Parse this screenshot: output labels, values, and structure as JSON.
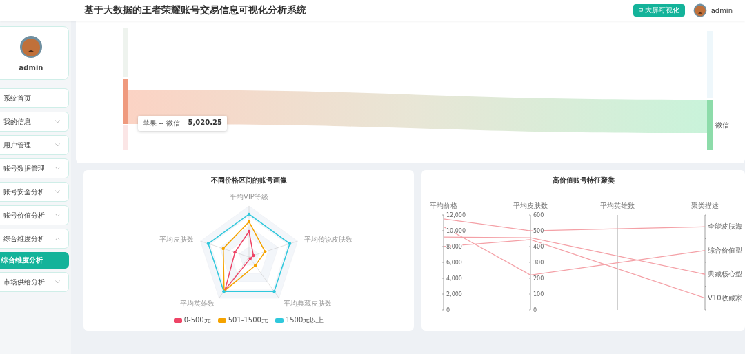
{
  "header": {
    "title": "基于大数据的王者荣耀账号交易信息可视化分析系统",
    "screen_button": "大屏可视化",
    "username": "admin"
  },
  "sidebar": {
    "profile": {
      "username": "admin"
    },
    "items": [
      {
        "label": "系统首页",
        "expandable": false
      },
      {
        "label": "我的信息",
        "expandable": true,
        "expanded": false
      },
      {
        "label": "用户管理",
        "expandable": true,
        "expanded": false
      },
      {
        "label": "账号数据管理",
        "expandable": true,
        "expanded": false
      },
      {
        "label": "账号安全分析",
        "expandable": true,
        "expanded": false
      },
      {
        "label": "账号价值分析",
        "expandable": true,
        "expanded": false
      },
      {
        "label": "综合维度分析",
        "expandable": true,
        "expanded": true,
        "children": [
          {
            "label": "综合维度分析",
            "selected": true
          }
        ]
      },
      {
        "label": "市场供给分析",
        "expandable": true,
        "expanded": false
      }
    ]
  },
  "sankey": {
    "tooltip": {
      "link": "苹果 -- 微信",
      "value": "5,020.25"
    },
    "target_label": "微信"
  },
  "radar": {
    "title": "不同价格区间的账号画像",
    "indicators": [
      "平均VIP等级",
      "平均皮肤数",
      "平均传说皮肤数",
      "平均英雄数",
      "平均典藏皮肤数"
    ],
    "legend": [
      {
        "name": "0-500元",
        "color": "#ee4466"
      },
      {
        "name": "501-1500元",
        "color": "#f5a300"
      },
      {
        "name": "1500元以上",
        "color": "#2fc8dc"
      }
    ]
  },
  "parallel": {
    "title": "高价值账号特征聚类",
    "axes": [
      {
        "name": "平均价格",
        "ticks": [
          "12,000",
          "10,000",
          "8,000",
          "6,000",
          "4,000",
          "2,000",
          "0"
        ]
      },
      {
        "name": "平均皮肤数",
        "ticks": [
          "600",
          "500",
          "400",
          "300",
          "200",
          "100",
          "0"
        ]
      },
      {
        "name": "平均英雄数"
      },
      {
        "name": "聚类描述",
        "ticks": [
          "全能皮肤海",
          "综合价值型",
          "典藏核心型",
          "V10收藏家"
        ]
      }
    ]
  }
}
